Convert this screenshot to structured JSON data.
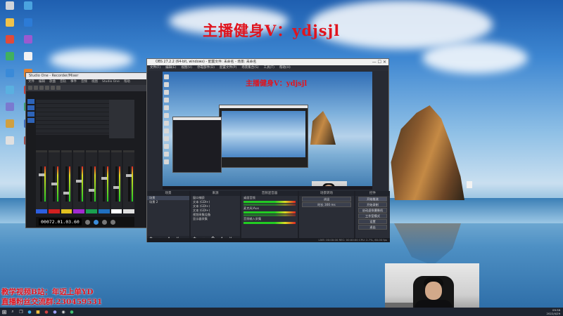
{
  "overlay": {
    "top_text": "主播健身V：ydjsjl",
    "bottom_line1": "教学视频B站：年迈上单YD",
    "bottom_line2": "直播粉丝交流群:230459531",
    "color": "#e0141e"
  },
  "desktop_icons": [
    "recycle-bin-icon",
    "app-icon",
    "folder-icon",
    "edge-icon",
    "app-icon",
    "app-icon",
    "app-icon",
    "file-icon",
    "app-icon",
    "app-icon",
    "app-icon",
    "app-icon",
    "app-icon",
    "app-icon",
    "app-icon",
    "app-icon",
    "app-icon",
    "app-icon"
  ],
  "mixer": {
    "title": "Studio One - Recorder/Mixer",
    "menu": [
      "文件",
      "编辑",
      "歌曲",
      "音轨",
      "事件",
      "音频",
      "视图",
      "Studio One",
      "帮助"
    ],
    "time": "00072.01.03.60",
    "strip_colors": [
      "#2d5fe0",
      "#d22020",
      "#e0c020",
      "#a02ad0",
      "#1aa050",
      "#2070c0",
      "#ffffff",
      "#e0e0e0"
    ]
  },
  "obs": {
    "title": "OBS 27.2.2 (64-bit, windows) - 配置文件: 未命名 - 场景: 未命名",
    "menu": [
      "文件(F)",
      "编辑(E)",
      "视图(V)",
      "停靠部件(D)",
      "配置文件(P)",
      "场景集合(S)",
      "工具(T)",
      "帮助(H)"
    ],
    "preview_text": "主播健身V：ydjsjl",
    "docks": {
      "scenes": {
        "title": "场景",
        "items": [
          "场景",
          "场景 2"
        ]
      },
      "sources": {
        "title": "来源",
        "items": [
          "窗口捕获",
          "文本 (GDI+)",
          "文本 (GDI+)",
          "文本 (GDI+)",
          "视频采集设备",
          "显示器采集"
        ]
      },
      "mixer": {
        "title": "音频混音器",
        "items": [
          "桌面音频",
          "麦克风/Aux",
          "音频输入采集"
        ]
      },
      "transitions": {
        "title": "场景转场",
        "items": [
          "淡出",
          "时长 300 ms"
        ]
      },
      "controls": {
        "title": "控件",
        "items": [
          "开始推流",
          "开始录制",
          "启动虚拟摄像机",
          "工作室模式",
          "设置",
          "退出"
        ]
      }
    },
    "status": "LIVE: 00:00:00  REC: 00:00:00  CPU: 2.7%, 60.00 fps"
  },
  "taskbar": {
    "start_glyph": "⊞",
    "tray_time": "09:38",
    "tray_date": "2022/4/29"
  }
}
